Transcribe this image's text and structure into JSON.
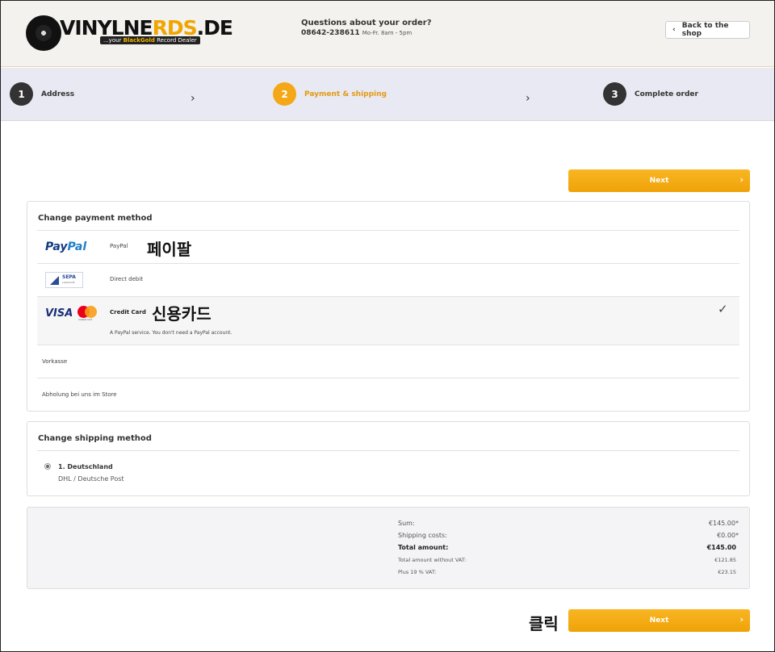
{
  "header": {
    "logo": {
      "wordmark_a": "VINYLNE",
      "wordmark_b": "RDS",
      "wordmark_c": ".DE",
      "tagline_a": "...your ",
      "tagline_b": "BlackGold",
      "tagline_c": " Record Dealer"
    },
    "question": "Questions about your order?",
    "phone": "08642-238611",
    "hours": "Mo-Fr. 8am - 5pm",
    "back_label": "Back to the shop"
  },
  "steps": [
    {
      "num": "1",
      "label": "Address"
    },
    {
      "num": "2",
      "label": "Payment & shipping"
    },
    {
      "num": "3",
      "label": "Complete order"
    }
  ],
  "next_label": "Next",
  "payment": {
    "title": "Change payment method",
    "methods": [
      {
        "logo_a": "Pay",
        "logo_b": "Pal",
        "label": "PayPal",
        "annotation": "페이팔"
      },
      {
        "logo": "SEPA",
        "logo_sub": "Lastschrift",
        "label": "Direct debit"
      },
      {
        "logo_visa": "VISA",
        "logo_mc": "mastercard",
        "label": "Credit Card",
        "annotation": "신용카드",
        "note": "A PayPal service. You don't need a PayPal account."
      },
      {
        "label": "Vorkasse"
      },
      {
        "label": "Abholung bei uns im Store"
      }
    ]
  },
  "shipping": {
    "title": "Change shipping method",
    "name": "1. Deutschland",
    "desc": "DHL / Deutsche Post"
  },
  "summary": {
    "sum_label": "Sum:",
    "sum_value": "€145.00*",
    "ship_label": "Shipping costs:",
    "ship_value": "€0.00*",
    "total_label": "Total amount:",
    "total_value": "€145.00",
    "novat_label": "Total amount without VAT:",
    "novat_value": "€121.85",
    "vat_label": "Plus 19 % VAT:",
    "vat_value": "€23.15"
  },
  "click_annotation": "클릭",
  "colors": {
    "accent": "#f5a817",
    "step_bg": "#e8e9f2",
    "header_bg": "#f3f2ee"
  }
}
